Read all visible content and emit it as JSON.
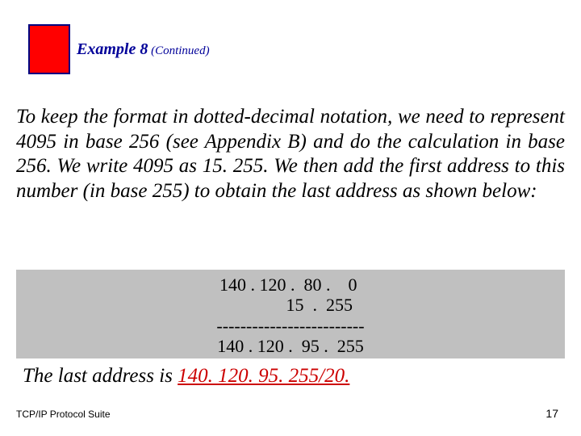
{
  "header": {
    "example_label": "Example 8",
    "continued": " (Continued)"
  },
  "body": {
    "paragraph": "To keep the format in dotted-decimal notation, we need to represent 4095 in base 256 (see Appendix B) and do the calculation in base 256. We write 4095 as 15. 255. We then add the first address to this number (in base 255) to obtain the last address as shown below:"
  },
  "calc": {
    "line1": "140 . 120 .  80 .    0 ",
    "line2": "             15  .  255",
    "line3": "-------------------------",
    "line4": "140 . 120 .  95 .  255"
  },
  "last": {
    "prefix": "The last address is ",
    "addr": "140. 120. 95. 255/20.",
    "period": ""
  },
  "footer": {
    "left": "TCP/IP Protocol Suite",
    "right": "17"
  }
}
